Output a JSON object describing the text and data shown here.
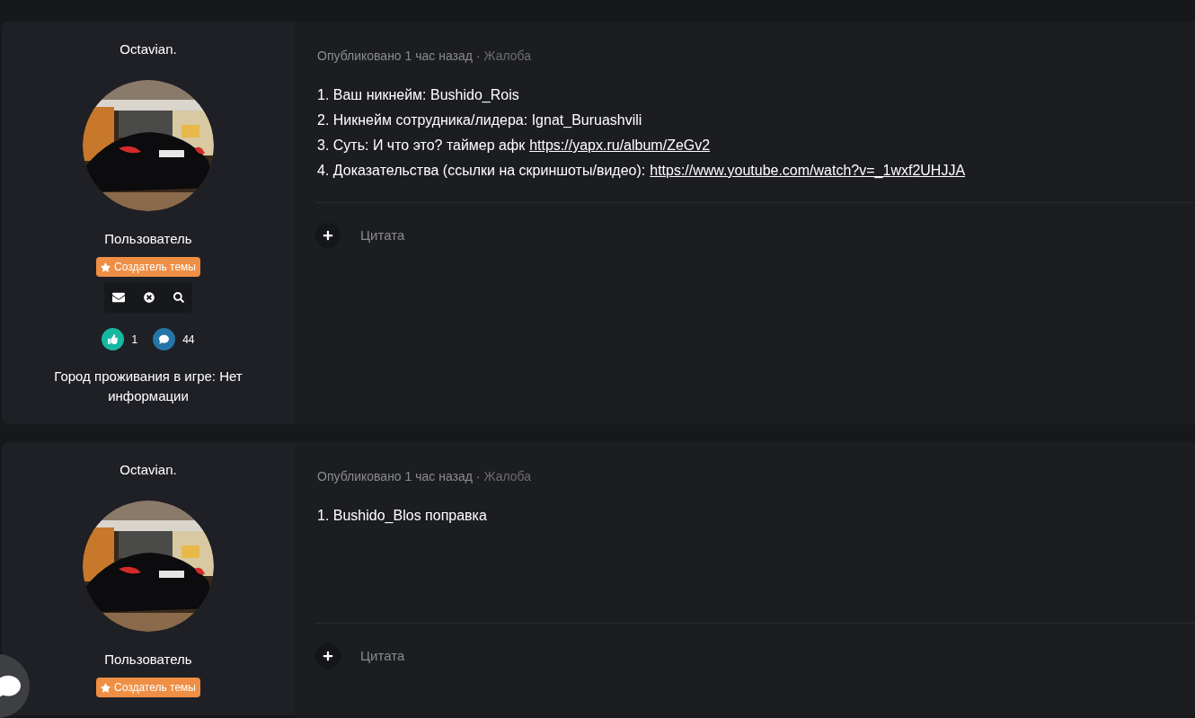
{
  "posts": [
    {
      "author": {
        "name": "Octavian.",
        "role": "Пользователь",
        "badge": "Создатель темы",
        "reactions": "1",
        "messages": "44",
        "field": "Город проживания в игре: Нет информации",
        "actions": true
      },
      "meta": {
        "posted": "Опубликовано 1 час назад",
        "separator": "·",
        "tag": "Жалоба"
      },
      "lines": [
        {
          "text": "1. Ваш никнейм: Bushido_Rois"
        },
        {
          "text": "2. Никнейм сотрудника/лидера: Ignat_Buruashvili"
        },
        {
          "text": "3. Суть: И что это? таймер афк",
          "link": "https://yapx.ru/album/ZeGv2"
        },
        {
          "text": "4. Доказательства (ссылки на скриншоты/видео):",
          "link": "https://www.youtube.com/watch?v=_1wxf2UHJJA"
        }
      ],
      "quote": "Цитата"
    },
    {
      "author": {
        "name": "Octavian.",
        "role": "Пользователь",
        "badge": "Создатель темы"
      },
      "meta": {
        "posted": "Опубликовано 1 час назад",
        "separator": "·",
        "tag": "Жалоба"
      },
      "lines": [
        {
          "text": "1. Bushido_Blos поправка"
        }
      ],
      "quote": "Цитата"
    }
  ]
}
